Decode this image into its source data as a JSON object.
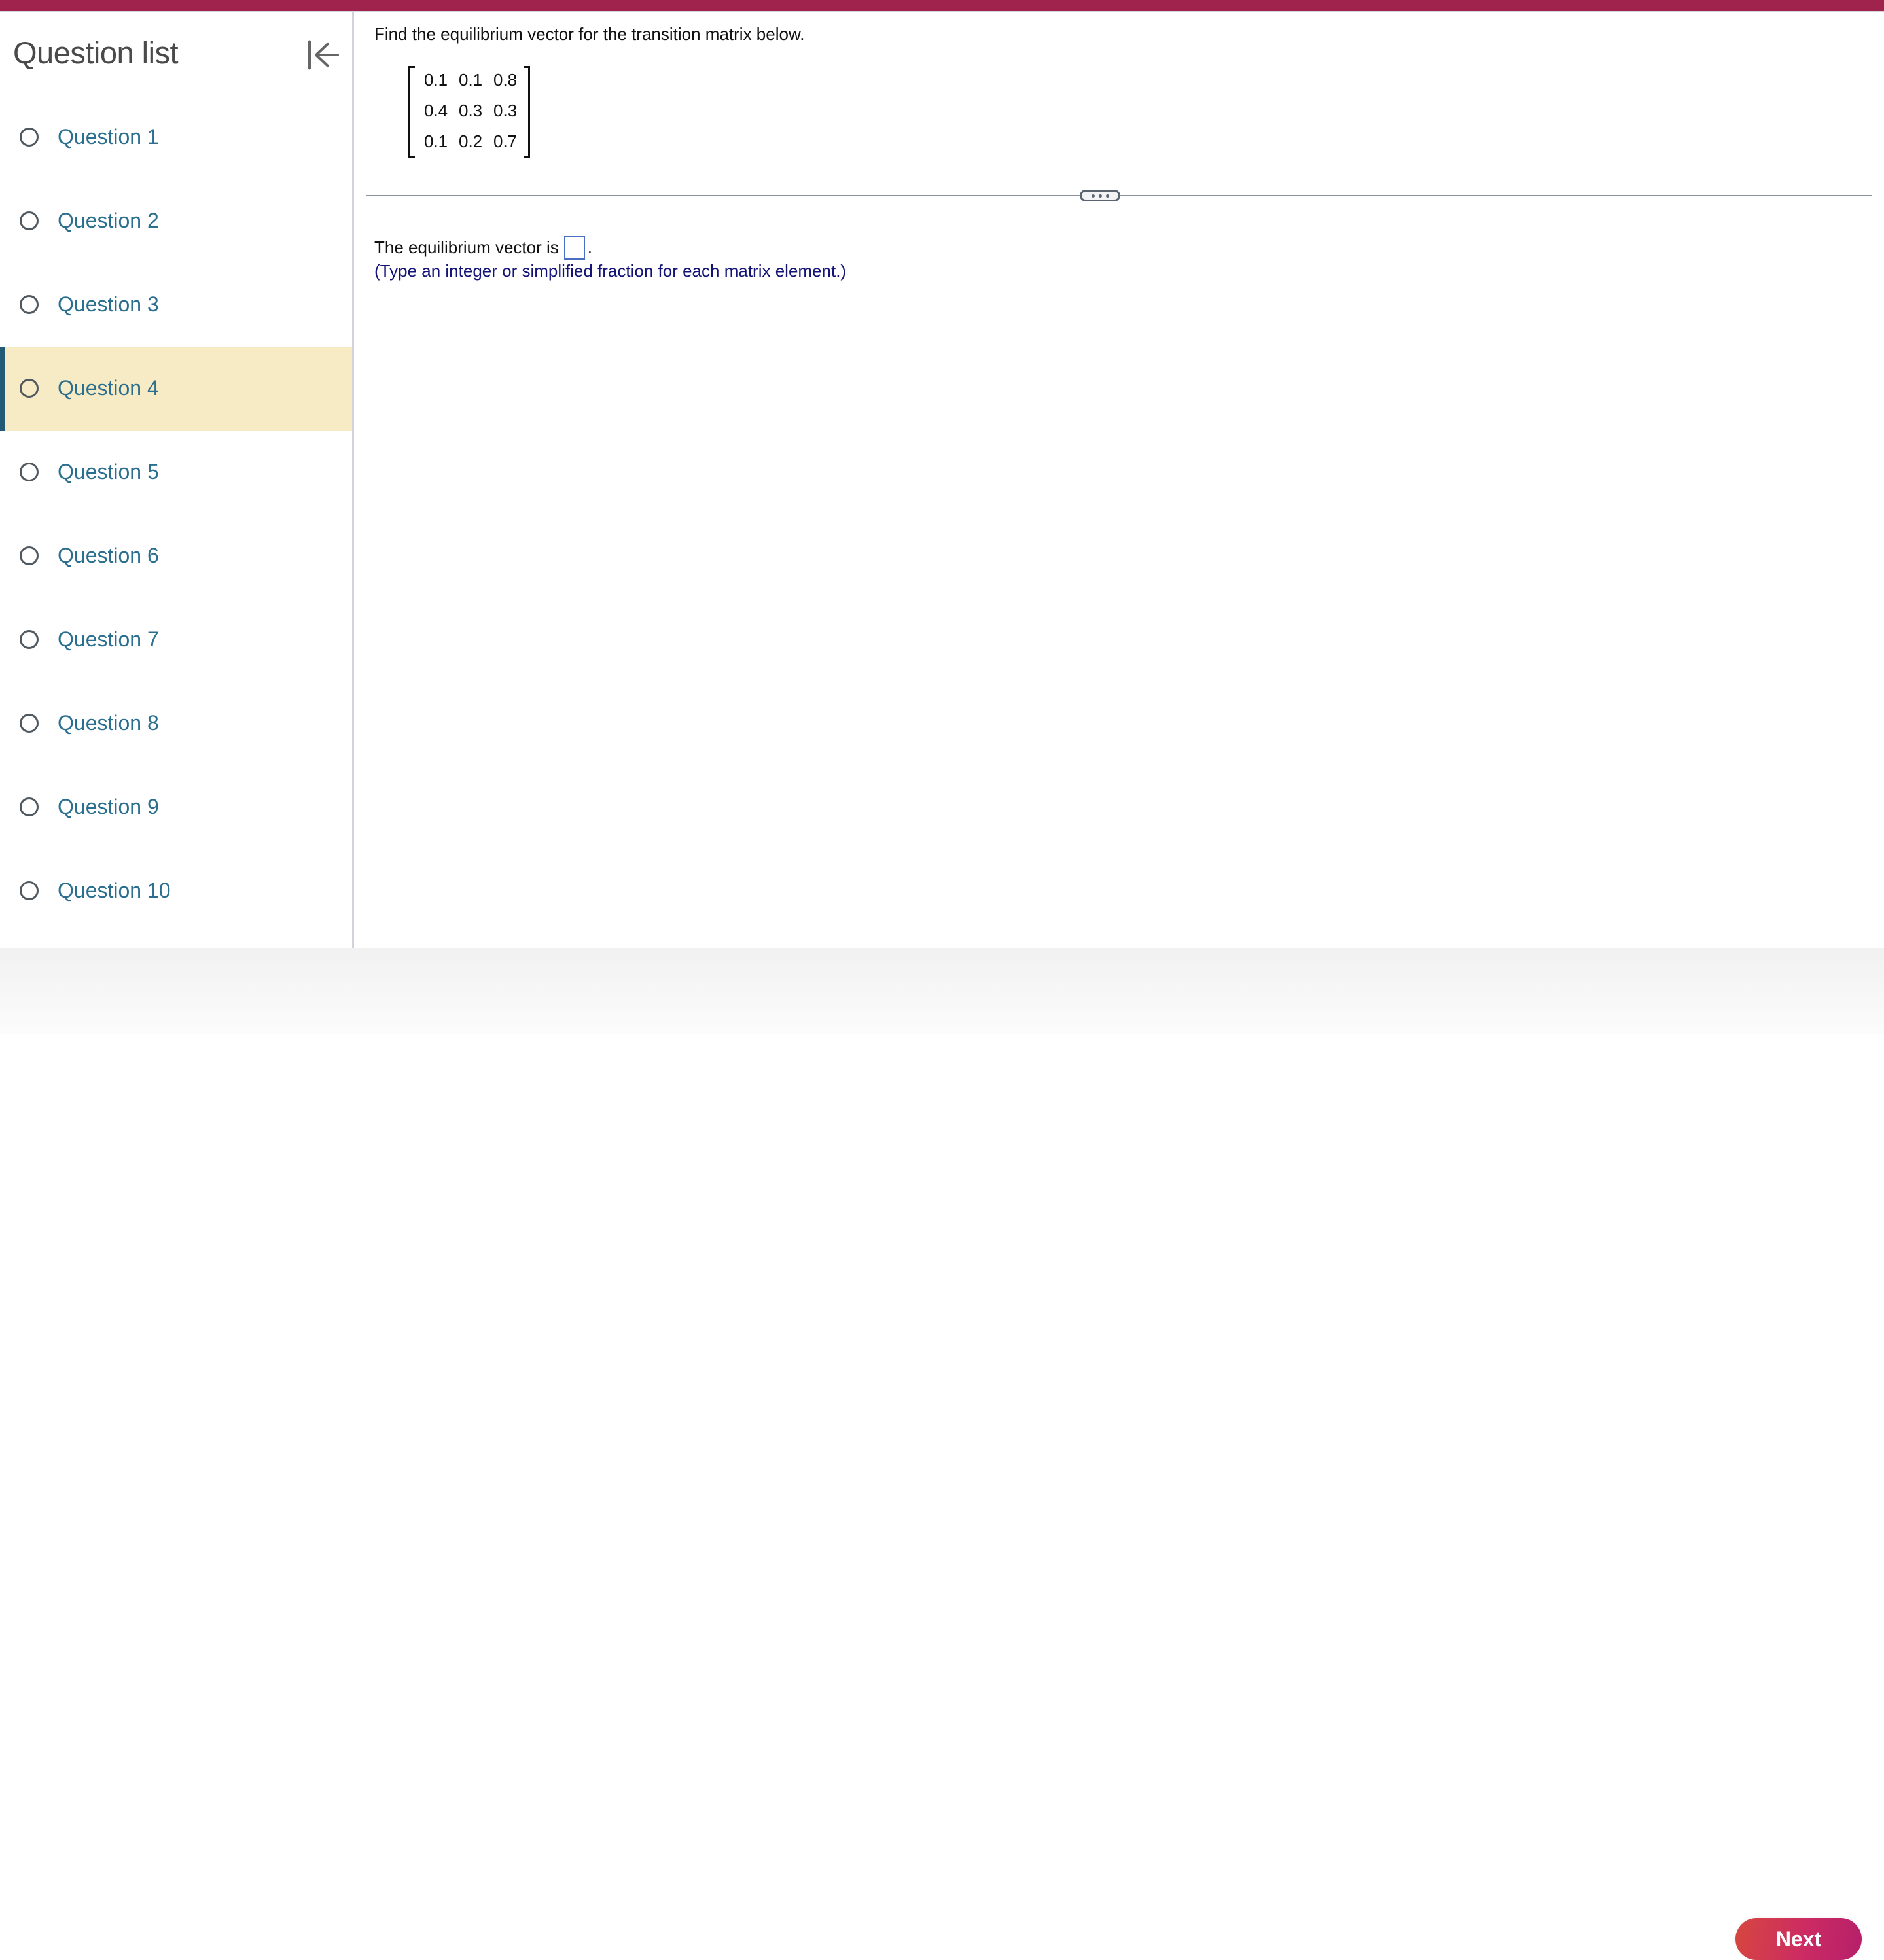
{
  "colors": {
    "top_bar": "#a0234d",
    "active_item_bg": "#f7ebc5",
    "active_item_indicator": "#235a76",
    "link_text": "#2a6f8f",
    "hint_text": "#141478",
    "next_button": "#cc2b63"
  },
  "sidebar": {
    "title": "Question list",
    "collapse_icon": "collapse-left-icon",
    "items": [
      {
        "label": "Question 1",
        "active": false
      },
      {
        "label": "Question 2",
        "active": false
      },
      {
        "label": "Question 3",
        "active": false
      },
      {
        "label": "Question 4",
        "active": true
      },
      {
        "label": "Question 5",
        "active": false
      },
      {
        "label": "Question 6",
        "active": false
      },
      {
        "label": "Question 7",
        "active": false
      },
      {
        "label": "Question 8",
        "active": false
      },
      {
        "label": "Question 9",
        "active": false
      },
      {
        "label": "Question 10",
        "active": false
      }
    ]
  },
  "question": {
    "prompt": "Find the equilibrium vector for the transition matrix below.",
    "matrix": [
      [
        "0.1",
        "0.1",
        "0.8"
      ],
      [
        "0.4",
        "0.3",
        "0.3"
      ],
      [
        "0.1",
        "0.2",
        "0.7"
      ]
    ],
    "more_button_icon": "ellipsis-icon",
    "answer_prefix": "The equilibrium vector is",
    "answer_suffix": ".",
    "answer_value": "",
    "hint": "(Type an integer or simplified fraction for each matrix element.)"
  },
  "footer": {
    "next_label": "Next"
  }
}
